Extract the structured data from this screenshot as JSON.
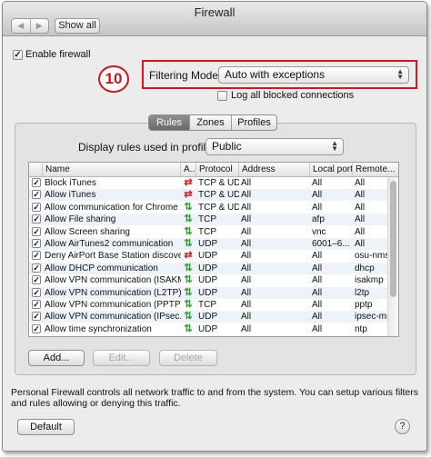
{
  "window": {
    "title": "Firewall",
    "nav_back": "◀",
    "nav_forward": "▶",
    "show_all": "Show all"
  },
  "enable_firewall": {
    "label": "Enable firewall",
    "checked": true
  },
  "step_badge": "10",
  "filtering_mode": {
    "label": "Filtering Mode:",
    "value": "Auto with exceptions"
  },
  "log_blocked": {
    "label": "Log all blocked connections",
    "checked": false
  },
  "tabs": [
    {
      "label": "Rules",
      "active": true
    },
    {
      "label": "Zones",
      "active": false
    },
    {
      "label": "Profiles",
      "active": false
    }
  ],
  "profile": {
    "label": "Display rules used in profile:",
    "value": "Public"
  },
  "table": {
    "columns": [
      "Name",
      "A...",
      "Protocol",
      "Address",
      "Local port",
      "Remote..."
    ],
    "rows": [
      {
        "checked": true,
        "name": "Block iTunes",
        "action": "block",
        "protocol": "TCP & UDP",
        "address": "All",
        "local": "All",
        "remote": "All"
      },
      {
        "checked": true,
        "name": "Allow iTunes",
        "action": "block",
        "protocol": "TCP & UDP",
        "address": "All",
        "local": "All",
        "remote": "All"
      },
      {
        "checked": true,
        "name": "Allow communication for Chrome",
        "action": "allow",
        "protocol": "TCP & UDP",
        "address": "All",
        "local": "All",
        "remote": "All"
      },
      {
        "checked": true,
        "name": "Allow File sharing",
        "action": "allow",
        "protocol": "TCP",
        "address": "All",
        "local": "afp",
        "remote": "All"
      },
      {
        "checked": true,
        "name": "Allow Screen sharing",
        "action": "allow",
        "protocol": "TCP",
        "address": "All",
        "local": "vnc",
        "remote": "All"
      },
      {
        "checked": true,
        "name": "Allow AirTunes2 communication",
        "action": "allow",
        "protocol": "UDP",
        "address": "All",
        "local": "6001–6...",
        "remote": "All"
      },
      {
        "checked": true,
        "name": "Deny AirPort Base Station discovery",
        "action": "block",
        "protocol": "UDP",
        "address": "All",
        "local": "All",
        "remote": "osu-nms"
      },
      {
        "checked": true,
        "name": "Allow DHCP communication",
        "action": "allow",
        "protocol": "UDP",
        "address": "All",
        "local": "All",
        "remote": "dhcp"
      },
      {
        "checked": true,
        "name": "Allow VPN communication (ISAKM...",
        "action": "allow",
        "protocol": "UDP",
        "address": "All",
        "local": "All",
        "remote": "isakmp"
      },
      {
        "checked": true,
        "name": "Allow VPN communication (L2TP)",
        "action": "allow",
        "protocol": "UDP",
        "address": "All",
        "local": "All",
        "remote": "l2tp"
      },
      {
        "checked": true,
        "name": "Allow VPN communication (PPTP)",
        "action": "allow",
        "protocol": "TCP",
        "address": "All",
        "local": "All",
        "remote": "pptp"
      },
      {
        "checked": true,
        "name": "Allow VPN communication (IPsec...",
        "action": "allow",
        "protocol": "UDP",
        "address": "All",
        "local": "All",
        "remote": "ipsec-ms"
      },
      {
        "checked": true,
        "name": "Allow time synchronization",
        "action": "allow",
        "protocol": "UDP",
        "address": "All",
        "local": "All",
        "remote": "ntp"
      }
    ]
  },
  "buttons": {
    "add": "Add...",
    "edit": "Edit...",
    "delete": "Delete",
    "default": "Default",
    "help": "?"
  },
  "description": "Personal Firewall controls all network traffic to and from the system. You can setup various filters and rules allowing or denying this traffic.",
  "colors": {
    "highlight": "#d8151b",
    "allow": "#2f9e2f",
    "block": "#d02424",
    "row_alt": "#eef3fa"
  },
  "icons": {
    "allow": "allow-arrows-icon",
    "block": "block-arrows-icon"
  }
}
